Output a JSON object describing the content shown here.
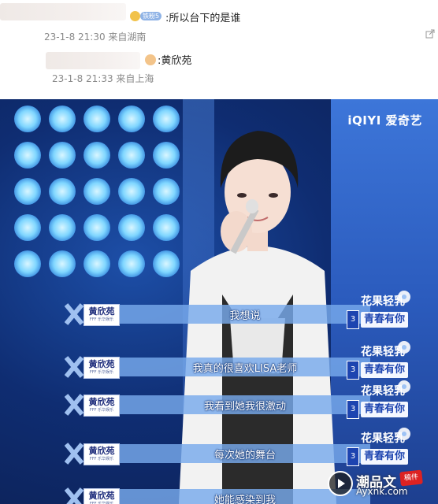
{
  "comments": [
    {
      "text": ":所以台下的是谁",
      "meta": "23-1-8 21:30 来自湖南",
      "badge": "铁粉5"
    },
    {
      "text": ":黄欣苑",
      "meta": "23-1-8 21:33 来自上海"
    }
  ],
  "video": {
    "logo": "iQIYI 爱奇艺",
    "speaker_name": "黄欣苑",
    "speaker_sub": "FFF 乐华娱乐",
    "subtitles": [
      "我想说",
      "我真的很喜欢LISA老师",
      "我看到她我很激动",
      "每次她的舞台",
      "她能感染到我"
    ],
    "sponsor": {
      "line1": "花果轻乳",
      "line2": "青春有你",
      "small": "蒙牛\n真果粒",
      "num": "3"
    },
    "watermark": {
      "text": "潮品文",
      "stamp": "稿件",
      "url": "Ayxnk.com"
    }
  },
  "colors": {
    "video_bg": "#0f2d72",
    "subtitle_bar": "#78aaeb",
    "accent_blue": "#1d44b0"
  }
}
